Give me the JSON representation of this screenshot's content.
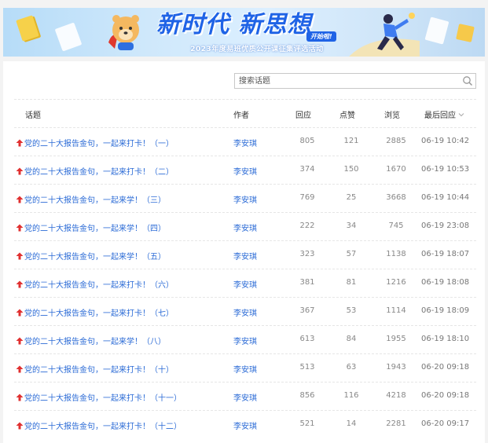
{
  "banner": {
    "title": "新时代 新思想",
    "badge": "开始啦!",
    "subtitle": "2023年度易班优质公开课征集评选活动"
  },
  "search": {
    "placeholder": "搜索话题"
  },
  "table": {
    "headers": {
      "topic": "话题",
      "author": "作者",
      "replies": "回应",
      "likes": "点赞",
      "views": "浏览",
      "last_reply": "最后回应"
    },
    "rows": [
      {
        "topic": "党的二十大报告金句，一起来打卡！（一）",
        "author": "李安琪",
        "replies": "805",
        "likes": "121",
        "views": "2885",
        "last_reply": "06-19 10:42"
      },
      {
        "topic": "党的二十大报告金句，一起来打卡！（二）",
        "author": "李安琪",
        "replies": "374",
        "likes": "150",
        "views": "1670",
        "last_reply": "06-19 10:53"
      },
      {
        "topic": "党的二十大报告金句，一起来学！（三）",
        "author": "李安琪",
        "replies": "769",
        "likes": "25",
        "views": "3668",
        "last_reply": "06-19 10:44"
      },
      {
        "topic": "党的二十大报告金句，一起来学！（四）",
        "author": "李安琪",
        "replies": "222",
        "likes": "34",
        "views": "745",
        "last_reply": "06-19 23:08"
      },
      {
        "topic": "党的二十大报告金句，一起来学！（五）",
        "author": "李安琪",
        "replies": "323",
        "likes": "57",
        "views": "1138",
        "last_reply": "06-19 18:07"
      },
      {
        "topic": "党的二十大报告金句，一起来打卡！（六）",
        "author": "李安琪",
        "replies": "381",
        "likes": "81",
        "views": "1216",
        "last_reply": "06-19 18:08"
      },
      {
        "topic": "党的二十大报告金句，一起来打卡！（七）",
        "author": "李安琪",
        "replies": "367",
        "likes": "53",
        "views": "1114",
        "last_reply": "06-19 18:09"
      },
      {
        "topic": "党的二十大报告金句，一起来学！（八）",
        "author": "李安琪",
        "replies": "613",
        "likes": "84",
        "views": "1955",
        "last_reply": "06-19 18:10"
      },
      {
        "topic": "党的二十大报告金句，一起来打卡！（十）",
        "author": "李安琪",
        "replies": "513",
        "likes": "63",
        "views": "1943",
        "last_reply": "06-20 09:18"
      },
      {
        "topic": "党的二十大报告金句，一起来打卡！（十一）",
        "author": "李安琪",
        "replies": "856",
        "likes": "116",
        "views": "4218",
        "last_reply": "06-20 09:18"
      },
      {
        "topic": "党的二十大报告金句，一起来打卡！（十二）",
        "author": "李安琪",
        "replies": "521",
        "likes": "14",
        "views": "2281",
        "last_reply": "06-20 09:17"
      }
    ]
  },
  "colors": {
    "link": "#2b6bd6",
    "pinned_arrow": "#e03030",
    "banner_title": "#1f63e6"
  },
  "icons": {
    "row_marker": "pinned-arrow-icon",
    "search": "search-icon",
    "sort": "chevron-down-icon"
  }
}
